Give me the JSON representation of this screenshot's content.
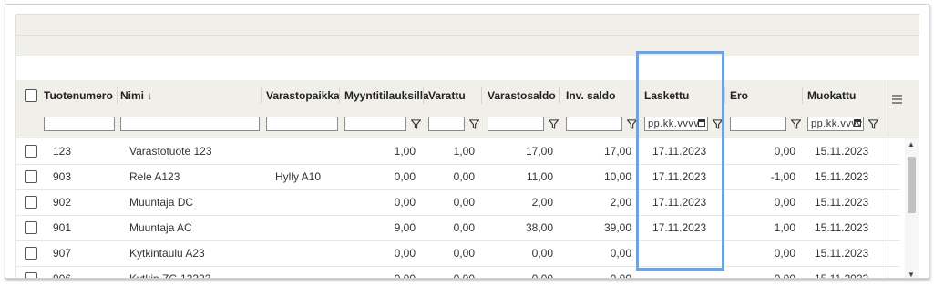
{
  "columns": [
    {
      "key": "tuotenumero",
      "label": "Tuotenumero"
    },
    {
      "key": "nimi",
      "label": "Nimi",
      "sort_icon": "arrow-down-icon",
      "sort_glyph": "↓"
    },
    {
      "key": "varastopaikka",
      "label": "Varastopaikka"
    },
    {
      "key": "myyntitilauksilla",
      "label": "Myyntitilauksilla"
    },
    {
      "key": "varattu",
      "label": "Varattu"
    },
    {
      "key": "varastosaldo",
      "label": "Varastosaldo"
    },
    {
      "key": "inv_saldo",
      "label": "Inv. saldo"
    },
    {
      "key": "laskettu",
      "label": "Laskettu"
    },
    {
      "key": "ero",
      "label": "Ero"
    },
    {
      "key": "muokattu",
      "label": "Muokattu"
    }
  ],
  "filters": {
    "date_placeholder_laskettu": "pp.kk.vvvv",
    "date_placeholder_muokattu": "pp.kk.vvvv",
    "filter_icon": "funnel-icon",
    "calendar_icon": "calendar-icon"
  },
  "rows": [
    {
      "tuotenumero": "123",
      "nimi": "Varastotuote 123",
      "varastopaikka": "",
      "myyntitilauksilla": "1,00",
      "varattu": "1,00",
      "varastosaldo": "17,00",
      "inv_saldo": "17,00",
      "laskettu": "17.11.2023",
      "ero": "0,00",
      "muokattu": "15.11.2023"
    },
    {
      "tuotenumero": "903",
      "nimi": "Rele A123",
      "varastopaikka": "Hylly A10",
      "myyntitilauksilla": "0,00",
      "varattu": "0,00",
      "varastosaldo": "11,00",
      "inv_saldo": "10,00",
      "laskettu": "17.11.2023",
      "ero": "-1,00",
      "muokattu": "15.11.2023"
    },
    {
      "tuotenumero": "902",
      "nimi": "Muuntaja DC",
      "varastopaikka": "",
      "myyntitilauksilla": "0,00",
      "varattu": "0,00",
      "varastosaldo": "2,00",
      "inv_saldo": "2,00",
      "laskettu": "17.11.2023",
      "ero": "0,00",
      "muokattu": "15.11.2023"
    },
    {
      "tuotenumero": "901",
      "nimi": "Muuntaja AC",
      "varastopaikka": "",
      "myyntitilauksilla": "9,00",
      "varattu": "0,00",
      "varastosaldo": "38,00",
      "inv_saldo": "39,00",
      "laskettu": "17.11.2023",
      "ero": "1,00",
      "muokattu": "15.11.2023"
    },
    {
      "tuotenumero": "907",
      "nimi": "Kytkintaulu A23",
      "varastopaikka": "",
      "myyntitilauksilla": "0,00",
      "varattu": "0,00",
      "varastosaldo": "0,00",
      "inv_saldo": "0,00",
      "laskettu": "",
      "ero": "0,00",
      "muokattu": "15.11.2023"
    },
    {
      "tuotenumero": "906",
      "nimi": "Kytkin ZC-12323",
      "varastopaikka": "",
      "myyntitilauksilla": "0,00",
      "varattu": "0,00",
      "varastosaldo": "0,00",
      "inv_saldo": "0,00",
      "laskettu": "",
      "ero": "0,00",
      "muokattu": "15.11.2023"
    }
  ],
  "icons": {
    "column_menu": "menu-icon",
    "scroll_up": "chevron-up-icon",
    "scroll_down": "chevron-down-icon"
  },
  "colors": {
    "highlight": "#6fa3d9",
    "header_bg": "#f1efe9"
  }
}
